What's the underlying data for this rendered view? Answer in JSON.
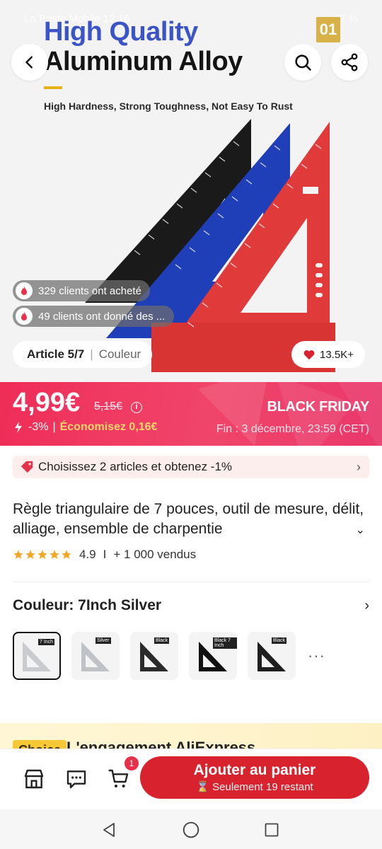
{
  "status_bar": {
    "carrier": "La Poste Mobile 12:16",
    "battery": "67 %"
  },
  "hero": {
    "title_line1": "High Quality",
    "title_line2": "Aluminum Alloy",
    "subtitle": "High Hardness, Strong Toughness, Not Easy To Rust",
    "badge": "01",
    "social": {
      "bought": "329 clients ont acheté",
      "reviewed": "49 clients ont donné des ..."
    },
    "article_label": "Article 5/7",
    "article_sep": "|",
    "article_color": "Couleur",
    "likes": "13.5K+"
  },
  "price": {
    "current": "4,99€",
    "old": "5,15€",
    "info_icon": "i",
    "discount": "-3%",
    "discount_sep": "|",
    "savings": "Économisez 0,16€",
    "event": "BLACK FRIDAY",
    "end_label": "Fin :",
    "end_date": "3 décembre, 23:59 (CET)"
  },
  "promo": {
    "text": "Choisissez 2 articles et obtenez -1%",
    "chevron": "›"
  },
  "product": {
    "title": "Règle triangulaire de 7 pouces, outil de mesure, délit, alliage, ensemble de charpentie",
    "expand_icon": "⌄",
    "rating": "4.9",
    "rating_sep": "I",
    "sold": "+ 1 000 vendus"
  },
  "color": {
    "label": "Couleur: 7Inch Silver",
    "chevron": "›",
    "options": [
      {
        "label": "7 Inch",
        "tone": "#c9cbce"
      },
      {
        "label": "Silver",
        "tone": "#bfc2c6"
      },
      {
        "label": "Black",
        "tone": "#2b2b2b"
      },
      {
        "label": "Black 7 Inch",
        "tone": "#111111"
      },
      {
        "label": "Black",
        "tone": "#1f1f1f"
      }
    ],
    "more": "···"
  },
  "promise": {
    "chip": "Choice",
    "text": "L'engagement AliExpress"
  },
  "action": {
    "cart_count": "1",
    "add_to_cart": "Ajouter au panier",
    "stock": "⌛ Seulement 19 restant"
  },
  "colors": {
    "price_banner": "#ef2d57",
    "cta": "#d8232f",
    "star": "#f5a623",
    "savings": "#ffd76b"
  }
}
